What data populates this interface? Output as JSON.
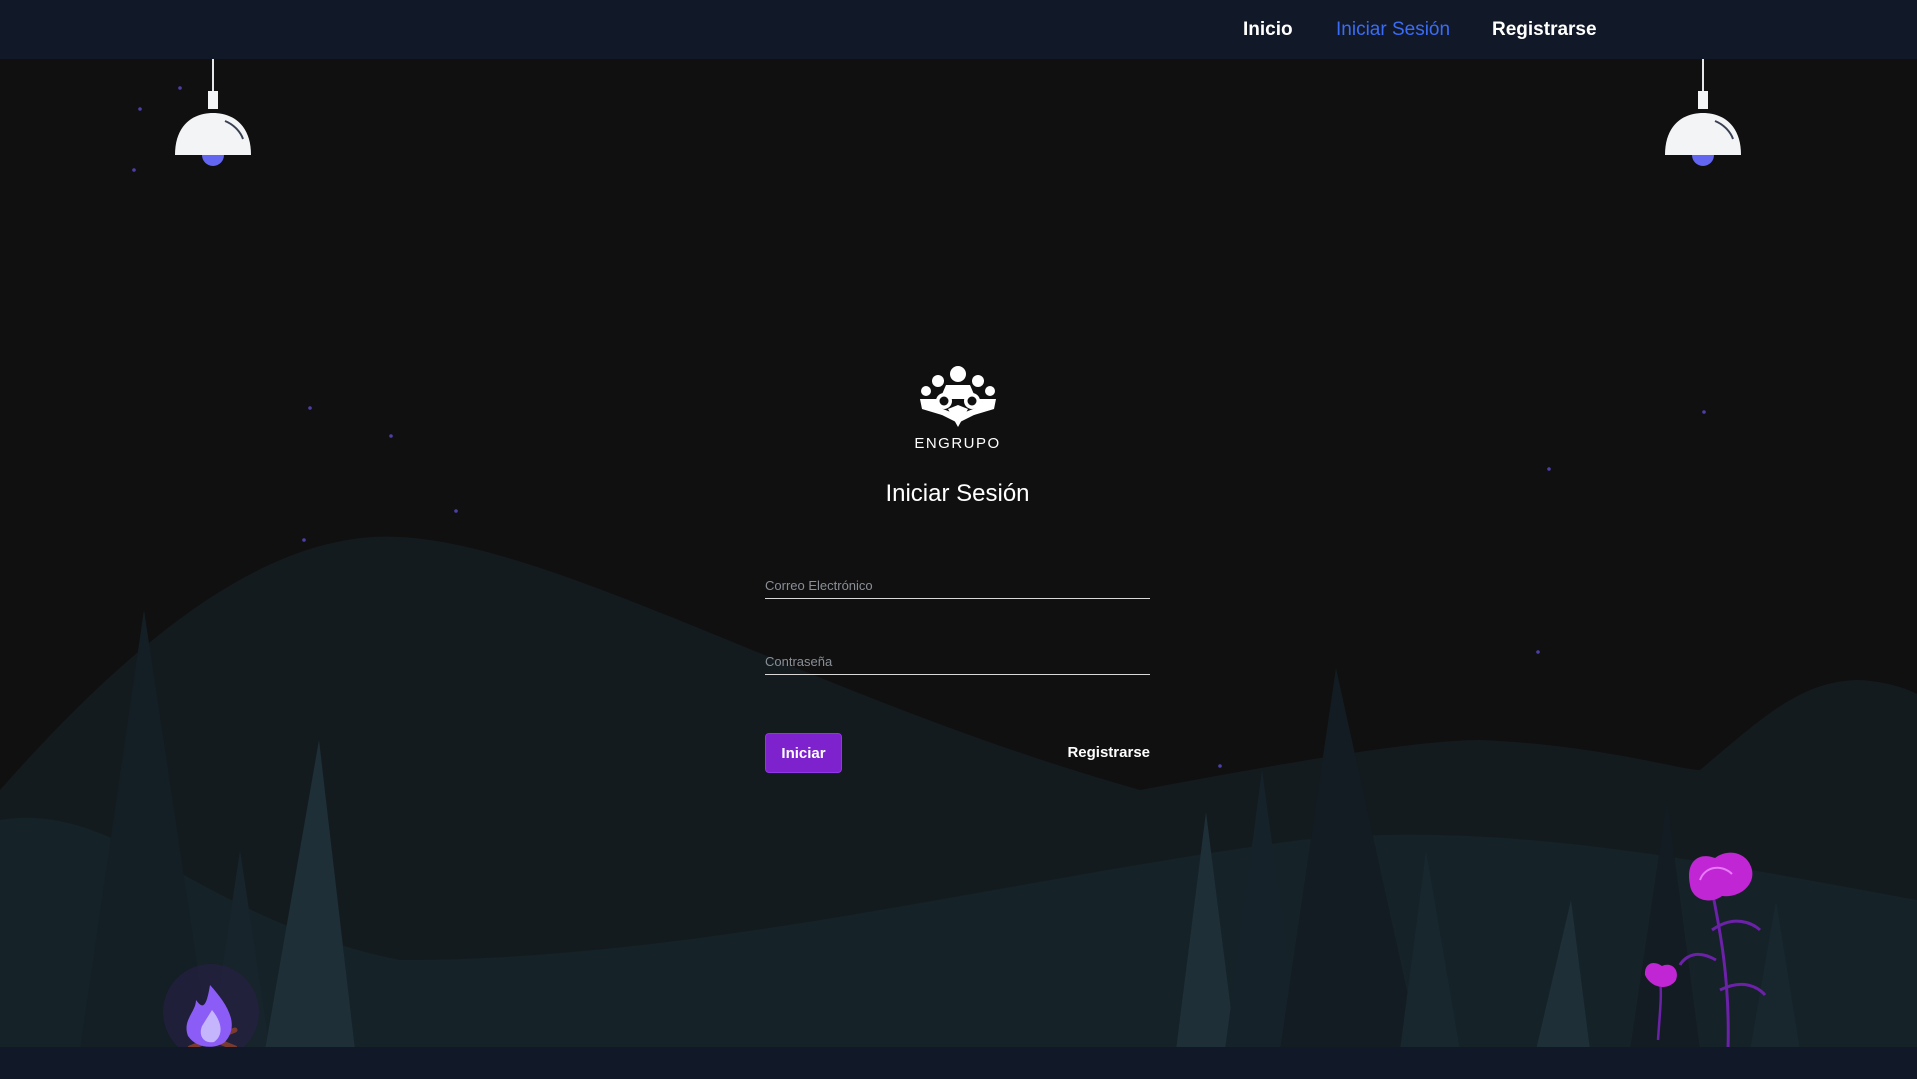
{
  "nav": {
    "home": "Inicio",
    "login": "Iniciar Sesión",
    "register": "Registrarse"
  },
  "brand": {
    "name": "ENGRUPO"
  },
  "login": {
    "title": "Iniciar Sesión",
    "email_placeholder": "Correo Electrónico",
    "password_placeholder": "Contraseña",
    "submit_label": "Iniciar",
    "register_link": "Registrarse"
  },
  "colors": {
    "nav_bg": "#111827",
    "page_bg": "#101010",
    "active_link": "#3b6cf5",
    "button": "#7e22ce",
    "mountain": "#141d22",
    "tree": "#1b2a32",
    "flame": "#8b5cf6",
    "flower": "#c026d3"
  },
  "icons": {
    "lamp": "ceiling-lamp-icon",
    "logo": "group-people-icon",
    "campfire": "campfire-icon",
    "flower": "flower-icon"
  }
}
